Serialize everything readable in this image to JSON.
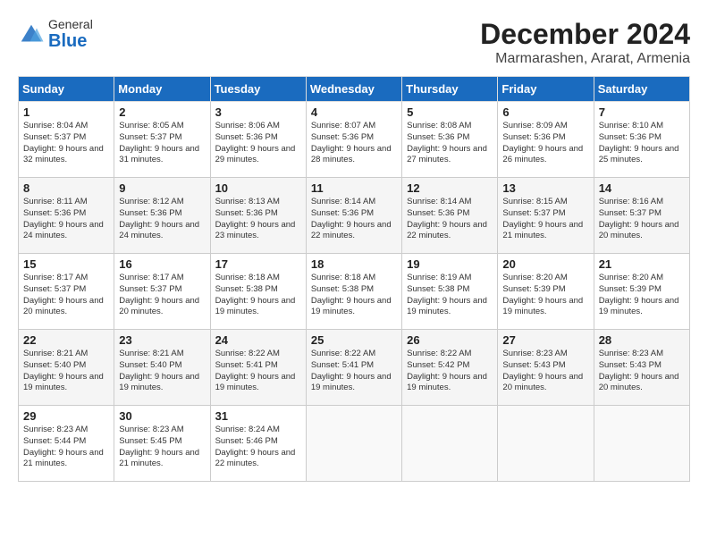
{
  "logo": {
    "general": "General",
    "blue": "Blue"
  },
  "header": {
    "month": "December 2024",
    "location": "Marmarashen, Ararat, Armenia"
  },
  "weekdays": [
    "Sunday",
    "Monday",
    "Tuesday",
    "Wednesday",
    "Thursday",
    "Friday",
    "Saturday"
  ],
  "weeks": [
    [
      {
        "day": "1",
        "sunrise": "8:04 AM",
        "sunset": "5:37 PM",
        "daylight": "9 hours and 32 minutes."
      },
      {
        "day": "2",
        "sunrise": "8:05 AM",
        "sunset": "5:37 PM",
        "daylight": "9 hours and 31 minutes."
      },
      {
        "day": "3",
        "sunrise": "8:06 AM",
        "sunset": "5:36 PM",
        "daylight": "9 hours and 29 minutes."
      },
      {
        "day": "4",
        "sunrise": "8:07 AM",
        "sunset": "5:36 PM",
        "daylight": "9 hours and 28 minutes."
      },
      {
        "day": "5",
        "sunrise": "8:08 AM",
        "sunset": "5:36 PM",
        "daylight": "9 hours and 27 minutes."
      },
      {
        "day": "6",
        "sunrise": "8:09 AM",
        "sunset": "5:36 PM",
        "daylight": "9 hours and 26 minutes."
      },
      {
        "day": "7",
        "sunrise": "8:10 AM",
        "sunset": "5:36 PM",
        "daylight": "9 hours and 25 minutes."
      }
    ],
    [
      {
        "day": "8",
        "sunrise": "8:11 AM",
        "sunset": "5:36 PM",
        "daylight": "9 hours and 24 minutes."
      },
      {
        "day": "9",
        "sunrise": "8:12 AM",
        "sunset": "5:36 PM",
        "daylight": "9 hours and 24 minutes."
      },
      {
        "day": "10",
        "sunrise": "8:13 AM",
        "sunset": "5:36 PM",
        "daylight": "9 hours and 23 minutes."
      },
      {
        "day": "11",
        "sunrise": "8:14 AM",
        "sunset": "5:36 PM",
        "daylight": "9 hours and 22 minutes."
      },
      {
        "day": "12",
        "sunrise": "8:14 AM",
        "sunset": "5:36 PM",
        "daylight": "9 hours and 22 minutes."
      },
      {
        "day": "13",
        "sunrise": "8:15 AM",
        "sunset": "5:37 PM",
        "daylight": "9 hours and 21 minutes."
      },
      {
        "day": "14",
        "sunrise": "8:16 AM",
        "sunset": "5:37 PM",
        "daylight": "9 hours and 20 minutes."
      }
    ],
    [
      {
        "day": "15",
        "sunrise": "8:17 AM",
        "sunset": "5:37 PM",
        "daylight": "9 hours and 20 minutes."
      },
      {
        "day": "16",
        "sunrise": "8:17 AM",
        "sunset": "5:37 PM",
        "daylight": "9 hours and 20 minutes."
      },
      {
        "day": "17",
        "sunrise": "8:18 AM",
        "sunset": "5:38 PM",
        "daylight": "9 hours and 19 minutes."
      },
      {
        "day": "18",
        "sunrise": "8:18 AM",
        "sunset": "5:38 PM",
        "daylight": "9 hours and 19 minutes."
      },
      {
        "day": "19",
        "sunrise": "8:19 AM",
        "sunset": "5:38 PM",
        "daylight": "9 hours and 19 minutes."
      },
      {
        "day": "20",
        "sunrise": "8:20 AM",
        "sunset": "5:39 PM",
        "daylight": "9 hours and 19 minutes."
      },
      {
        "day": "21",
        "sunrise": "8:20 AM",
        "sunset": "5:39 PM",
        "daylight": "9 hours and 19 minutes."
      }
    ],
    [
      {
        "day": "22",
        "sunrise": "8:21 AM",
        "sunset": "5:40 PM",
        "daylight": "9 hours and 19 minutes."
      },
      {
        "day": "23",
        "sunrise": "8:21 AM",
        "sunset": "5:40 PM",
        "daylight": "9 hours and 19 minutes."
      },
      {
        "day": "24",
        "sunrise": "8:22 AM",
        "sunset": "5:41 PM",
        "daylight": "9 hours and 19 minutes."
      },
      {
        "day": "25",
        "sunrise": "8:22 AM",
        "sunset": "5:41 PM",
        "daylight": "9 hours and 19 minutes."
      },
      {
        "day": "26",
        "sunrise": "8:22 AM",
        "sunset": "5:42 PM",
        "daylight": "9 hours and 19 minutes."
      },
      {
        "day": "27",
        "sunrise": "8:23 AM",
        "sunset": "5:43 PM",
        "daylight": "9 hours and 20 minutes."
      },
      {
        "day": "28",
        "sunrise": "8:23 AM",
        "sunset": "5:43 PM",
        "daylight": "9 hours and 20 minutes."
      }
    ],
    [
      {
        "day": "29",
        "sunrise": "8:23 AM",
        "sunset": "5:44 PM",
        "daylight": "9 hours and 21 minutes."
      },
      {
        "day": "30",
        "sunrise": "8:23 AM",
        "sunset": "5:45 PM",
        "daylight": "9 hours and 21 minutes."
      },
      {
        "day": "31",
        "sunrise": "8:24 AM",
        "sunset": "5:46 PM",
        "daylight": "9 hours and 22 minutes."
      },
      null,
      null,
      null,
      null
    ]
  ]
}
